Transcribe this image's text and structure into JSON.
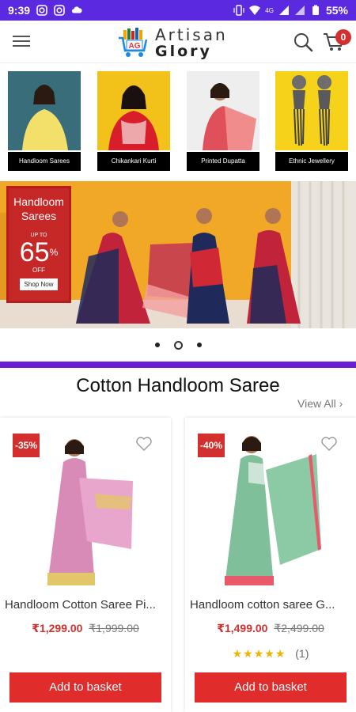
{
  "status_bar": {
    "time": "9:39",
    "battery": "55%",
    "network": "4G"
  },
  "header": {
    "logo_line1": "Artisan",
    "logo_line2": "Glory",
    "logo_badge": "AG",
    "cart_count": "0"
  },
  "categories": [
    {
      "label": "Handloom Sarees"
    },
    {
      "label": "Chikankari Kurti"
    },
    {
      "label": "Printed Dupatta"
    },
    {
      "label": "Ethnic Jewellery"
    }
  ],
  "banner": {
    "title": "Handloom Sarees",
    "upto": "UP TO",
    "percent": "65",
    "percent_sign": "%",
    "off": "OFF",
    "cta": "Shop Now"
  },
  "carousel": {
    "active_index": 1,
    "count": 3
  },
  "section": {
    "title": "Cotton Handloom Saree",
    "view_all": "View All"
  },
  "products": [
    {
      "discount": "-35%",
      "name": "Handloom Cotton Saree Pi...",
      "price": "₹1,299.00",
      "old_price": "₹1,999.00",
      "button": "Add to basket"
    },
    {
      "discount": "-40%",
      "name": "Handloom cotton saree G...",
      "price": "₹1,499.00",
      "old_price": "₹2,499.00",
      "stars": "★★★★★",
      "rating_count": "(1)",
      "button": "Add to basket"
    }
  ],
  "colors": {
    "status_bar": "#5b2ae0",
    "accent_red": "#e12c2c",
    "divider_purple": "#6a1fd1",
    "star": "#f0b400"
  }
}
